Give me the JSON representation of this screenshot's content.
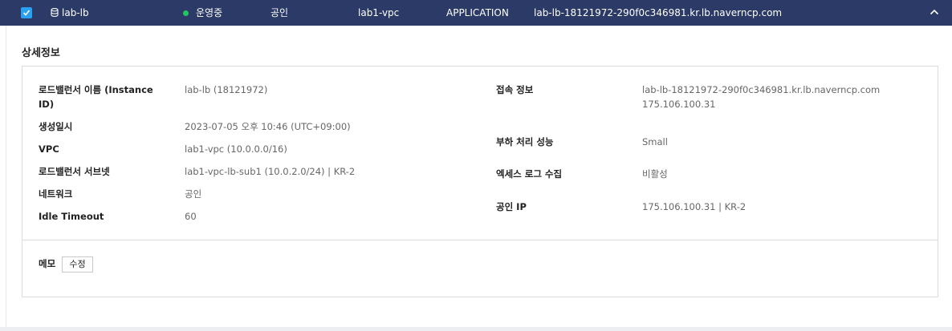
{
  "header": {
    "name": "lab-lb",
    "status": "운영중",
    "network_type": "공인",
    "vpc": "lab1-vpc",
    "lb_type": "APPLICATION",
    "domain": "lab-lb-18121972-290f0c346981.kr.lb.naverncp.com",
    "colors": {
      "bar": "#2b3a66",
      "checkbox": "#2aa0f0",
      "status_dot": "#22c55e"
    },
    "icons": {
      "checkbox": "check-icon",
      "db": "database-icon",
      "collapse": "chevron-up-icon"
    }
  },
  "detail": {
    "section_title": "상세정보",
    "left": [
      {
        "label": "로드밸런서 이름 (Instance ID)",
        "value": "lab-lb (18121972)"
      },
      {
        "label": "생성일시",
        "value": "2023-07-05 오후 10:46 (UTC+09:00)"
      },
      {
        "label": "VPC",
        "value": "lab1-vpc (10.0.0.0/16)"
      },
      {
        "label": "로드밸런서 서브넷",
        "value": "lab1-vpc-lb-sub1 (10.0.2.0/24) | KR-2"
      },
      {
        "label": "네트워크",
        "value": "공인"
      },
      {
        "label": "Idle Timeout",
        "value": "60"
      }
    ],
    "right": [
      {
        "label": "접속 정보",
        "value": "lab-lb-18121972-290f0c346981.kr.lb.naverncp.com",
        "value2": "175.106.100.31"
      },
      {
        "label": "부하 처리 성능",
        "value": "Small"
      },
      {
        "label": "엑세스 로그 수집",
        "value": "비활성"
      },
      {
        "label": "공인 IP",
        "value": "175.106.100.31 | KR-2"
      }
    ],
    "memo": {
      "label": "메모",
      "edit_button": "수정"
    }
  }
}
